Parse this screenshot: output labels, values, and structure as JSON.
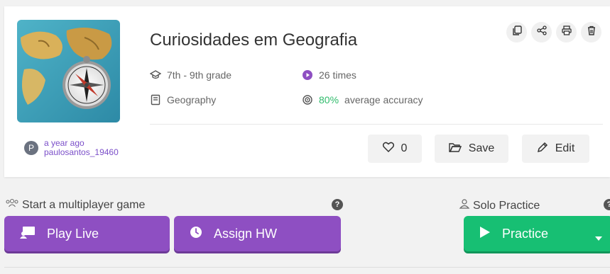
{
  "quiz": {
    "title": "Curiosidades em Geografia",
    "grade": "7th - 9th grade",
    "subject": "Geography",
    "plays": "26 times",
    "accuracy_value": "80%",
    "accuracy_label": "average accuracy"
  },
  "author": {
    "initial": "P",
    "time": "a year ago",
    "username": "paulosantos_19460"
  },
  "actions": {
    "likes": "0",
    "save": "Save",
    "edit": "Edit"
  },
  "multiplayer": {
    "label": "Start a multiplayer game",
    "play_live": "Play Live",
    "assign_hw": "Assign HW"
  },
  "solo": {
    "label": "Solo Practice",
    "practice": "Practice"
  },
  "colors": {
    "purple": "#8e4fc2",
    "green": "#17bf73",
    "accent_text": "#7b4fc9"
  }
}
